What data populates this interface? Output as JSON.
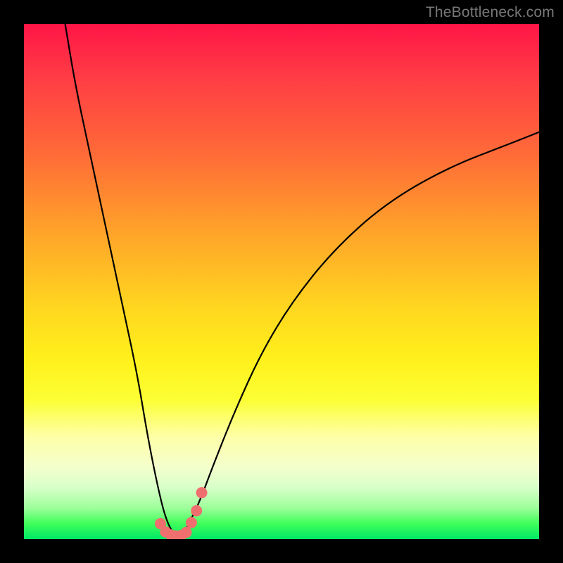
{
  "watermark": {
    "text": "TheBottleneck.com"
  },
  "chart_data": {
    "type": "line",
    "title": "",
    "xlabel": "",
    "ylabel": "",
    "xlim": [
      0,
      100
    ],
    "ylim": [
      0,
      100
    ],
    "series": [
      {
        "name": "bottleneck-curve",
        "x": [
          8,
          10,
          13,
          16,
          19,
          22,
          24,
          26,
          27.5,
          29,
          30,
          31,
          32,
          34,
          37,
          41,
          46,
          52,
          60,
          70,
          82,
          95,
          100
        ],
        "values": [
          100,
          88,
          74,
          60,
          46,
          32,
          20,
          10,
          4,
          1,
          0.5,
          1,
          3,
          7,
          15,
          25,
          36,
          46,
          56,
          65,
          72,
          77,
          79
        ]
      }
    ],
    "markers": {
      "name": "highlight-dots",
      "color": "#ef6f6f",
      "x": [
        26.5,
        27.5,
        28.5,
        29.5,
        30.5,
        31.5,
        32.5,
        33.5,
        34.5
      ],
      "values": [
        3.0,
        1.4,
        0.8,
        0.6,
        0.7,
        1.3,
        3.2,
        5.5,
        9.0
      ]
    },
    "background": "rainbow-gradient-red-to-green-vertical"
  }
}
